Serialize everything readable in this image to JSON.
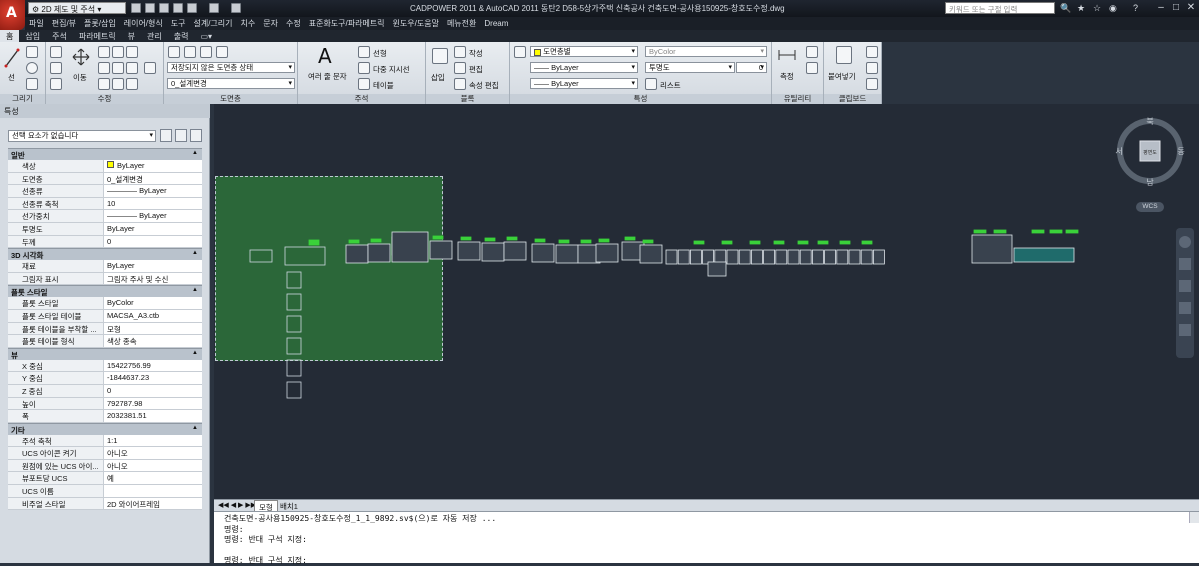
{
  "app": {
    "workspace": "2D 제도 및 주석",
    "title": "CADPOWER 2011 & AutoCAD 2011 동탄2 D58-5상가주택 신축공사 건축도면-공사용150925-창호도수정.dwg",
    "search_placeholder": "키워드 또는 구절 입력"
  },
  "menu": [
    "파일",
    "편집(E)",
    "뷰",
    "삽입",
    "형식",
    "도구",
    "그리기",
    "치수",
    "수정",
    "표준화도구",
    "파라메트릭",
    "윈도우",
    "도움말",
    "메뉴전환",
    "Dream"
  ],
  "menu_display": [
    "파일",
    "편집/뷰",
    "플롯/삽입",
    "레이어/형식",
    "도구",
    "설계/그리기",
    "치수",
    "문자",
    "수정",
    "표준화도구/파라메트릭",
    "윈도우/도움말",
    "메뉴전환",
    "Dream"
  ],
  "tabs": [
    "홈",
    "삽입",
    "주석",
    "파라메트릭",
    "뷰",
    "관리",
    "출력"
  ],
  "ribbon": {
    "draw": {
      "label": "그리기",
      "line": "선"
    },
    "modify": {
      "label": "수정",
      "move": "이동"
    },
    "layers": {
      "label": "도면층",
      "state": "저장되지 않은 도면층 상태",
      "current": "0_설계변경"
    },
    "annotation": {
      "label": "주석",
      "multitext": "여러 줄 문자",
      "linear": "선형",
      "mleader": "다중 지시선",
      "table": "테이블"
    },
    "block": {
      "label": "블록",
      "insert": "삽입",
      "create": "작성",
      "edit": "편집",
      "attr": "속성 편집"
    },
    "properties": {
      "label": "특성",
      "color": "도면층별",
      "color2": "ByColor",
      "linetype": "ByLayer",
      "lineweight": "ByLayer",
      "transparency": "투명도",
      "transp_val": "0",
      "list": "리스트"
    },
    "utilities": {
      "label": "유틸리티",
      "measure": "측정"
    },
    "clipboard": {
      "label": "클립보드",
      "paste": "붙여넣기"
    }
  },
  "palette": {
    "title": "특성",
    "selection": "선택 요소가 없습니다",
    "sections": [
      {
        "name": "일반",
        "rows": [
          [
            "색상",
            "ByLayer"
          ],
          [
            "도면층",
            "0_설계변경"
          ],
          [
            "선종류",
            "———— ByLayer"
          ],
          [
            "선종류 축척",
            "10"
          ],
          [
            "선가중치",
            "———— ByLayer"
          ],
          [
            "투명도",
            "ByLayer"
          ],
          [
            "두께",
            "0"
          ]
        ]
      },
      {
        "name": "3D 시각화",
        "rows": [
          [
            "재료",
            "ByLayer"
          ],
          [
            "그림자 표시",
            "그림자 주사 및 수신"
          ]
        ]
      },
      {
        "name": "플롯 스타일",
        "rows": [
          [
            "플롯 스타일",
            "ByColor"
          ],
          [
            "플롯 스타일 테이블",
            "MACSA_A3.ctb"
          ],
          [
            "플롯 테이블을 부착할 ...",
            "모형"
          ],
          [
            "플롯 테이블 형식",
            "색상 종속"
          ]
        ]
      },
      {
        "name": "뷰",
        "rows": [
          [
            "X 중심",
            "15422756.99"
          ],
          [
            "Y 중심",
            "-1844637.23"
          ],
          [
            "Z 중심",
            "0"
          ],
          [
            "높이",
            "792787.98"
          ],
          [
            "폭",
            "2032381.51"
          ]
        ]
      },
      {
        "name": "기타",
        "rows": [
          [
            "주석 축척",
            "1:1"
          ],
          [
            "UCS 아이콘 켜기",
            "아니오"
          ],
          [
            "원점에 있는 UCS 아이...",
            "아니오"
          ],
          [
            "뷰포트당 UCS",
            "예"
          ],
          [
            "UCS 이름",
            ""
          ],
          [
            "비주얼 스타일",
            "2D 와이어프레임"
          ]
        ]
      }
    ]
  },
  "viewcube": {
    "n": "북",
    "s": "남",
    "e": "동",
    "w": "서",
    "top": "평면도",
    "wcs": "WCS"
  },
  "layout_tabs": [
    "모형",
    "배치1"
  ],
  "command": [
    "건축도면-공사용150925-창호도수정_1_1_9892.sv$(으)로 자동 저장 ...",
    "명령:",
    "명령: 반대 구석 지정:",
    "",
    "명령: 반대 구석 지정:"
  ],
  "colors": {
    "selection_fill": "#2c6b3a",
    "canvas": "#242b36",
    "accent": "#d8e6f0"
  }
}
